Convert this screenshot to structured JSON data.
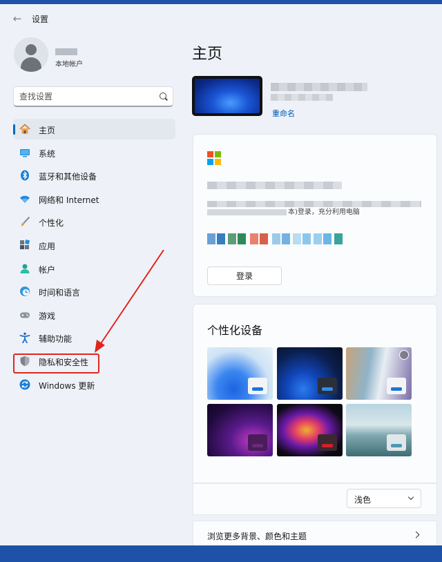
{
  "app": {
    "title": "设置"
  },
  "user": {
    "account_type": "本地帐户"
  },
  "search": {
    "placeholder": "查找设置"
  },
  "sidebar": {
    "items": [
      {
        "label": "主页",
        "icon": "home-icon"
      },
      {
        "label": "系统",
        "icon": "system-monitor-icon"
      },
      {
        "label": "蓝牙和其他设备",
        "icon": "bluetooth-icon"
      },
      {
        "label": "网络和 Internet",
        "icon": "wifi-icon"
      },
      {
        "label": "个性化",
        "icon": "brush-icon"
      },
      {
        "label": "应用",
        "icon": "apps-icon"
      },
      {
        "label": "帐户",
        "icon": "person-icon"
      },
      {
        "label": "时间和语言",
        "icon": "clock-globe-icon"
      },
      {
        "label": "游戏",
        "icon": "gamepad-icon"
      },
      {
        "label": "辅助功能",
        "icon": "accessibility-icon"
      },
      {
        "label": "隐私和安全性",
        "icon": "shield-icon"
      },
      {
        "label": "Windows 更新",
        "icon": "update-icon"
      }
    ],
    "active_item": "主页",
    "highlighted_item": "隐私和安全性"
  },
  "main": {
    "title": "主页",
    "device": {
      "rename_label": "重命名"
    },
    "promo": {
      "visible_text": "本)登录，充分利用电脑",
      "login_label": "登录"
    },
    "personalization": {
      "title": "个性化设备",
      "mode_value": "浅色",
      "browse_label": "浏览更多背景、颜色和主题"
    }
  },
  "colors": {
    "accent": "#0067c0",
    "annotation": "#e0251d",
    "desktop": "#1e52a8"
  }
}
